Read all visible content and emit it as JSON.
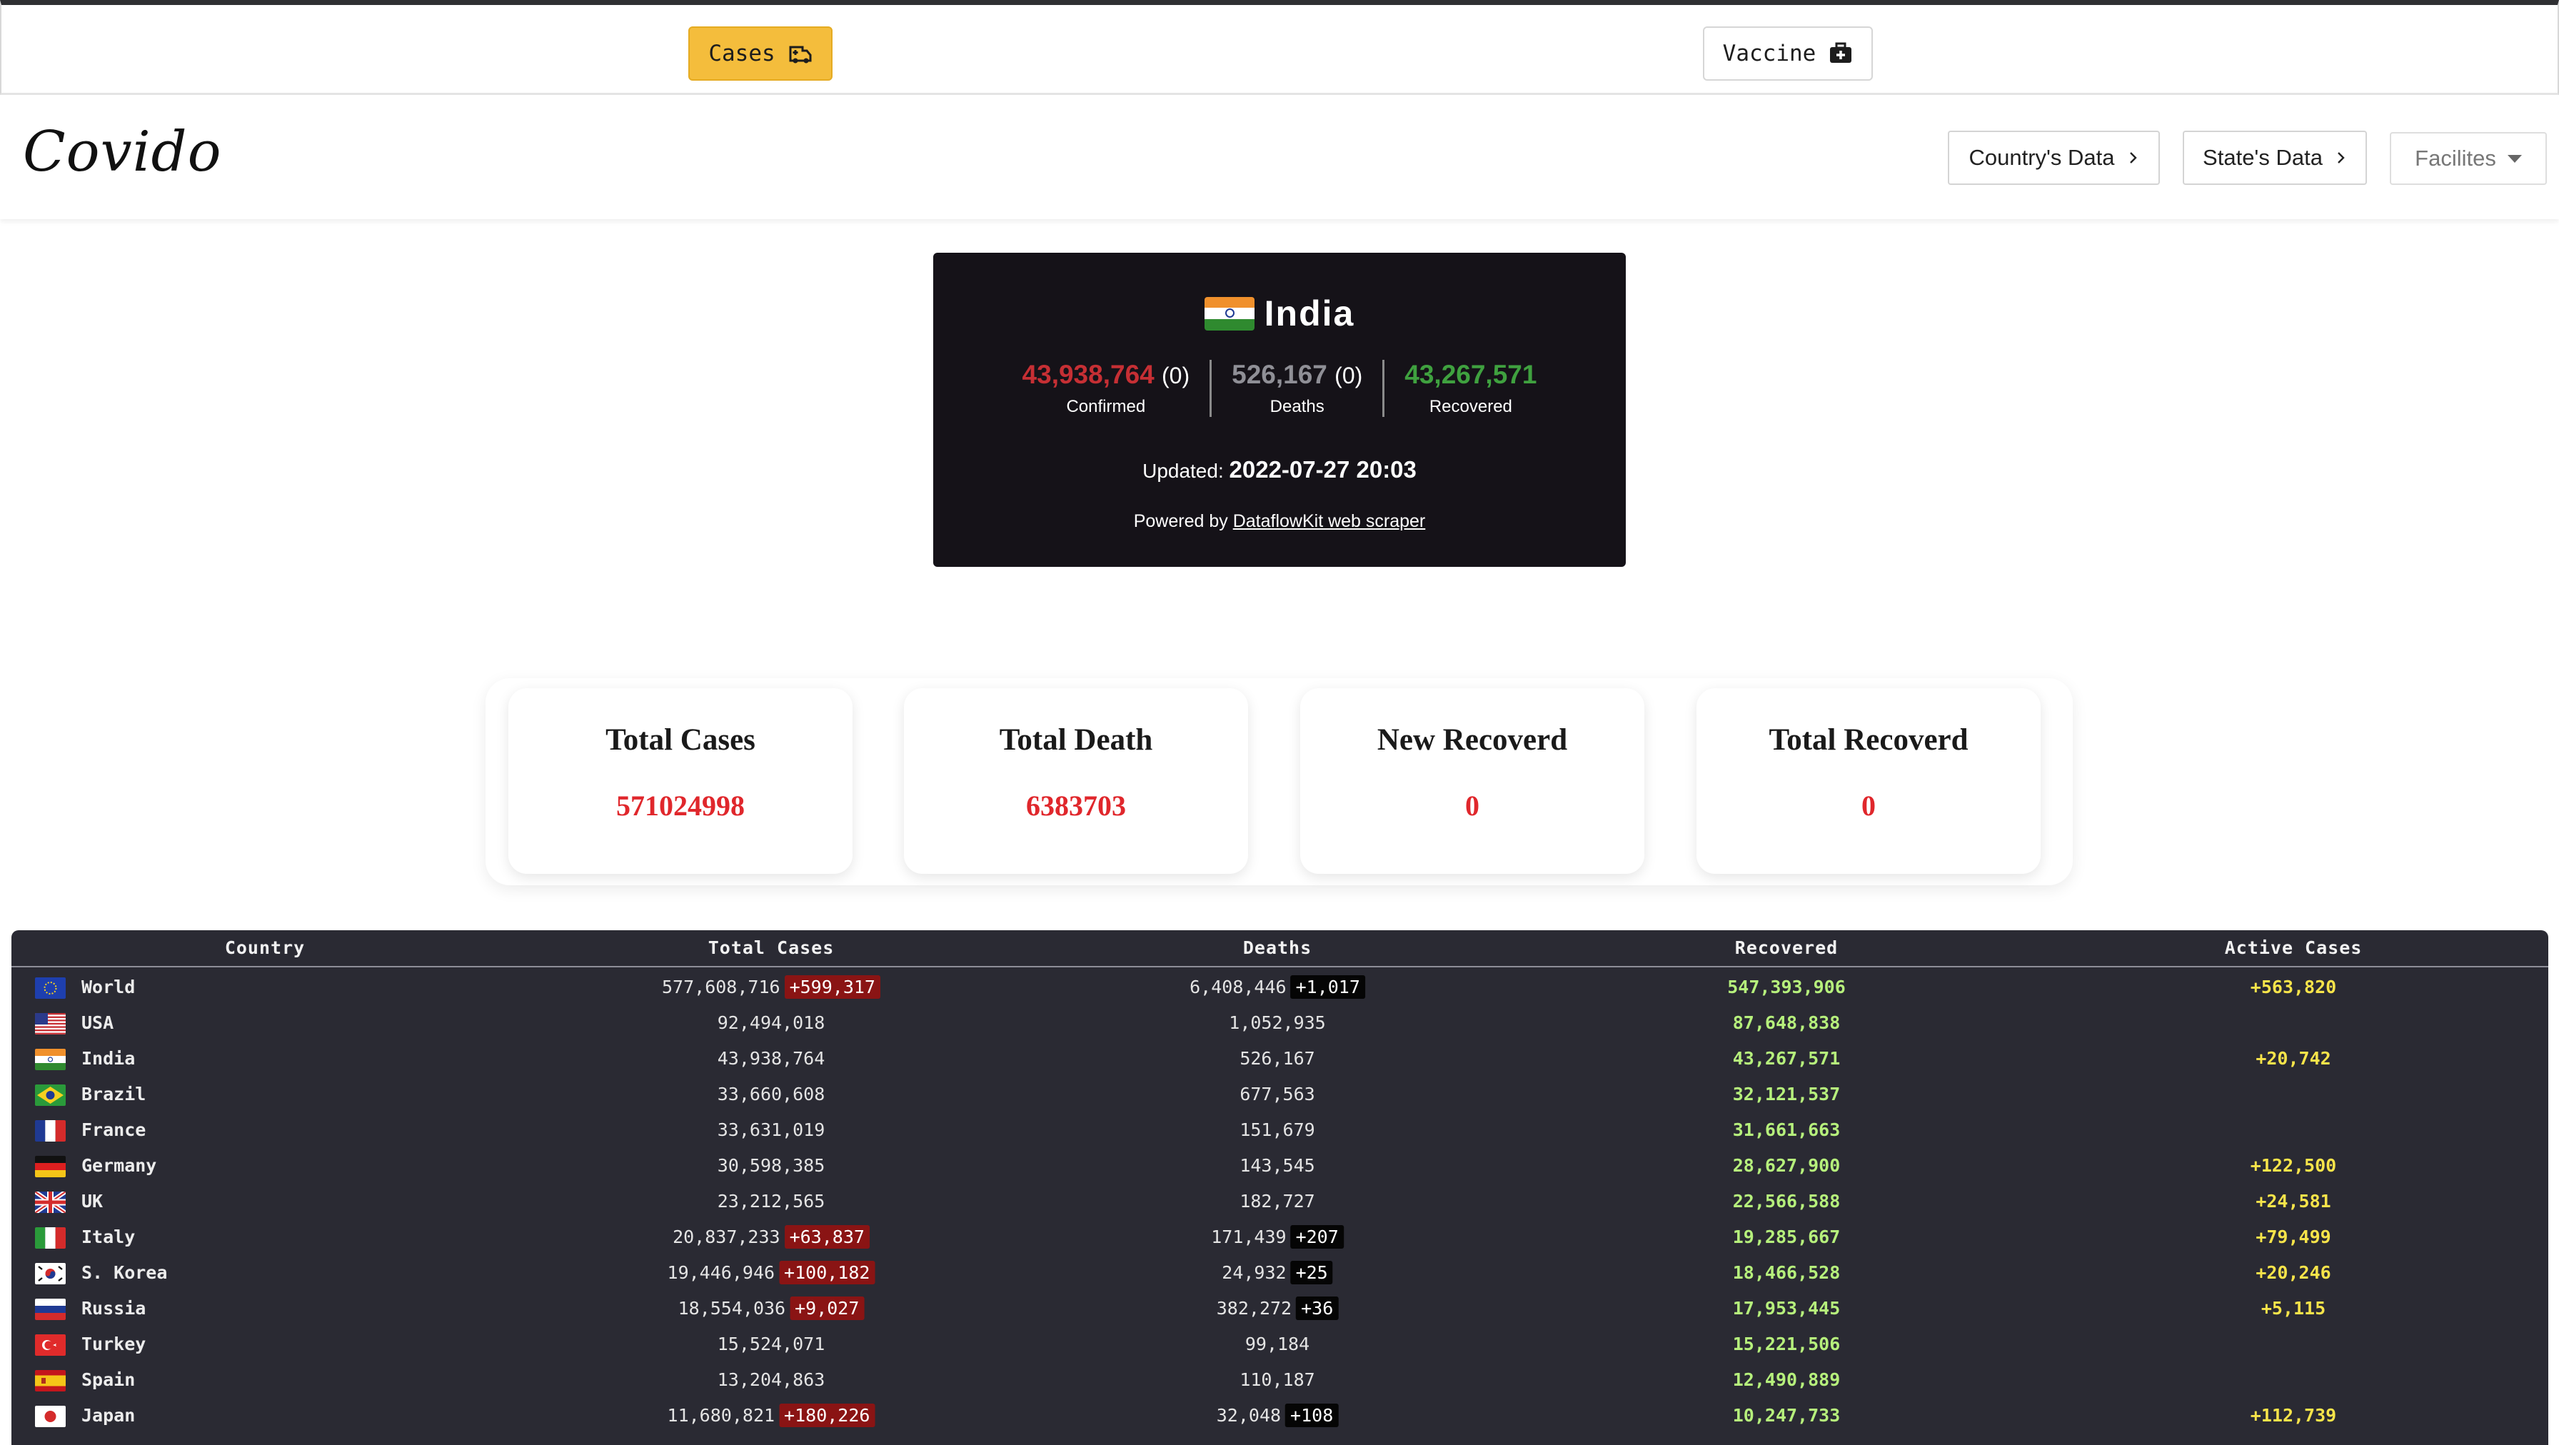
{
  "tabs": {
    "cases_label": "Cases",
    "vaccine_label": "Vaccine"
  },
  "navbar": {
    "logo": "Covido",
    "countrys_data": "Country's Data",
    "states_data": "State's Data",
    "facilities": "Facilites"
  },
  "india": {
    "name": "India",
    "confirmed": "43,938,764",
    "confirmed_delta": "(0)",
    "confirmed_label": "Confirmed",
    "deaths": "526,167",
    "deaths_delta": "(0)",
    "deaths_label": "Deaths",
    "recovered": "43,267,571",
    "recovered_label": "Recovered",
    "updated_label": "Updated:",
    "updated_value": "2022-07-27 20:03",
    "powered_by": "Powered by",
    "powered_link": "DataflowKit web scraper"
  },
  "summary": [
    {
      "title": "Total Cases",
      "value": "571024998"
    },
    {
      "title": "Total Death",
      "value": "6383703"
    },
    {
      "title": "New Recoverd",
      "value": "0"
    },
    {
      "title": "Total Recoverd",
      "value": "0"
    }
  ],
  "table": {
    "headers": [
      "Country",
      "Total Cases",
      "Deaths",
      "Recovered",
      "Active Cases"
    ],
    "rows": [
      {
        "flag": "eu",
        "country": "World",
        "total": "577,608,716",
        "total_new": "+599,317",
        "deaths": "6,408,446",
        "deaths_new": "+1,017",
        "recovered": "547,393,906",
        "active": "+563,820"
      },
      {
        "flag": "us",
        "country": "USA",
        "total": "92,494,018",
        "total_new": "",
        "deaths": "1,052,935",
        "deaths_new": "",
        "recovered": "87,648,838",
        "active": ""
      },
      {
        "flag": "in",
        "country": "India",
        "total": "43,938,764",
        "total_new": "",
        "deaths": "526,167",
        "deaths_new": "",
        "recovered": "43,267,571",
        "active": "+20,742"
      },
      {
        "flag": "br",
        "country": "Brazil",
        "total": "33,660,608",
        "total_new": "",
        "deaths": "677,563",
        "deaths_new": "",
        "recovered": "32,121,537",
        "active": ""
      },
      {
        "flag": "fr",
        "country": "France",
        "total": "33,631,019",
        "total_new": "",
        "deaths": "151,679",
        "deaths_new": "",
        "recovered": "31,661,663",
        "active": ""
      },
      {
        "flag": "de",
        "country": "Germany",
        "total": "30,598,385",
        "total_new": "",
        "deaths": "143,545",
        "deaths_new": "",
        "recovered": "28,627,900",
        "active": "+122,500"
      },
      {
        "flag": "gb",
        "country": "UK",
        "total": "23,212,565",
        "total_new": "",
        "deaths": "182,727",
        "deaths_new": "",
        "recovered": "22,566,588",
        "active": "+24,581"
      },
      {
        "flag": "it",
        "country": "Italy",
        "total": "20,837,233",
        "total_new": "+63,837",
        "deaths": "171,439",
        "deaths_new": "+207",
        "recovered": "19,285,667",
        "active": "+79,499"
      },
      {
        "flag": "kr",
        "country": "S. Korea",
        "total": "19,446,946",
        "total_new": "+100,182",
        "deaths": "24,932",
        "deaths_new": "+25",
        "recovered": "18,466,528",
        "active": "+20,246"
      },
      {
        "flag": "ru",
        "country": "Russia",
        "total": "18,554,036",
        "total_new": "+9,027",
        "deaths": "382,272",
        "deaths_new": "+36",
        "recovered": "17,953,445",
        "active": "+5,115"
      },
      {
        "flag": "tr",
        "country": "Turkey",
        "total": "15,524,071",
        "total_new": "",
        "deaths": "99,184",
        "deaths_new": "",
        "recovered": "15,221,506",
        "active": ""
      },
      {
        "flag": "es",
        "country": "Spain",
        "total": "13,204,863",
        "total_new": "",
        "deaths": "110,187",
        "deaths_new": "",
        "recovered": "12,490,889",
        "active": ""
      },
      {
        "flag": "jp",
        "country": "Japan",
        "total": "11,680,821",
        "total_new": "+180,226",
        "deaths": "32,048",
        "deaths_new": "+108",
        "recovered": "10,247,733",
        "active": "+112,739"
      }
    ]
  },
  "colors": {
    "cases_tab": "#f4bd3c",
    "confirmed": "#c62f34",
    "deaths": "#8f8f96",
    "recovered": "#3fa13f",
    "summary_value": "#e0272c",
    "table_bg": "#2a2a33",
    "recovered_col": "#b6f07c",
    "active_col": "#f7e44a"
  },
  "icons": {
    "cases": "ambulance-icon",
    "vaccine": "medical-kit-icon",
    "nav_arrow": "chevron-right-icon",
    "dropdown": "caret-down-icon"
  }
}
